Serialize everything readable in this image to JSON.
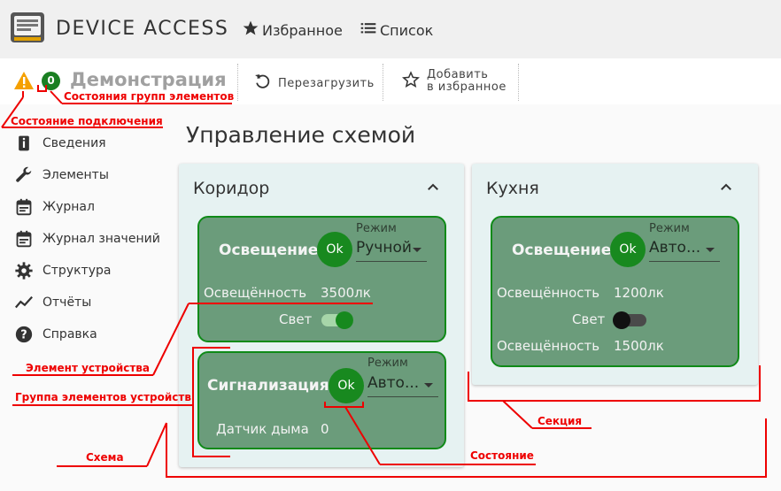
{
  "header": {
    "app_title": "DEVICE ACCESS",
    "nav": [
      {
        "label": "Избранное",
        "icon": "star-icon"
      },
      {
        "label": "Список",
        "icon": "list-icon"
      }
    ]
  },
  "subheader": {
    "title": "Демонстрация",
    "warning_icon": "warning-icon",
    "badge_count": "0",
    "actions": [
      {
        "label": "Перезагрузить",
        "icon": "refresh-icon"
      },
      {
        "line1": "Добавить",
        "line2": "в избранное",
        "icon": "star-outline-icon"
      }
    ]
  },
  "sidebar": {
    "items": [
      {
        "label": "Сведения",
        "icon": "info-icon"
      },
      {
        "label": "Элементы",
        "icon": "wrench-icon"
      },
      {
        "label": "Журнал",
        "icon": "calendar-icon"
      },
      {
        "label": "Журнал значений",
        "icon": "calendar-icon"
      },
      {
        "label": "Структура",
        "icon": "gear-icon"
      },
      {
        "label": "Отчёты",
        "icon": "chart-line-icon"
      },
      {
        "label": "Справка",
        "icon": "help-icon"
      }
    ]
  },
  "main": {
    "page_title": "Управление схемой",
    "sections": [
      {
        "title": "Коридор",
        "groups": [
          {
            "name": "Освещение",
            "status": "Ok",
            "mode_label": "Режим",
            "mode_value": "Ручной",
            "rows": [
              {
                "label": "Освещённость",
                "value": "3500лк"
              },
              {
                "label": "Свет",
                "toggle_on": true
              }
            ]
          },
          {
            "name": "Сигнализация",
            "status": "Ok",
            "mode_label": "Режим",
            "mode_value": "Авто...",
            "rows": [
              {
                "label": "Датчик дыма",
                "value": "0"
              }
            ]
          }
        ]
      },
      {
        "title": "Кухня",
        "groups": [
          {
            "name": "Освещение",
            "status": "Ok",
            "mode_label": "Режим",
            "mode_value": "Авто...",
            "rows": [
              {
                "label": "Освещённость",
                "value": "1200лк"
              },
              {
                "label": "Свет",
                "toggle_on": false
              },
              {
                "label": "Освещённость",
                "value": "1500лк"
              }
            ]
          }
        ]
      }
    ]
  },
  "annotations": {
    "group_states": "Состояния групп элементов",
    "connection_state": "Состояние подключения",
    "device_element": "Элемент устройства",
    "device_element_group": "Группа элементов устройств",
    "scheme": "Схема",
    "section": "Секция",
    "state": "Состояние"
  },
  "colors": {
    "ok_green": "#18891f",
    "group_fill": "#6b9c7b",
    "section_bg": "#e6f2f2",
    "annotation_red": "#e00000",
    "warning_orange": "#f5a000"
  }
}
